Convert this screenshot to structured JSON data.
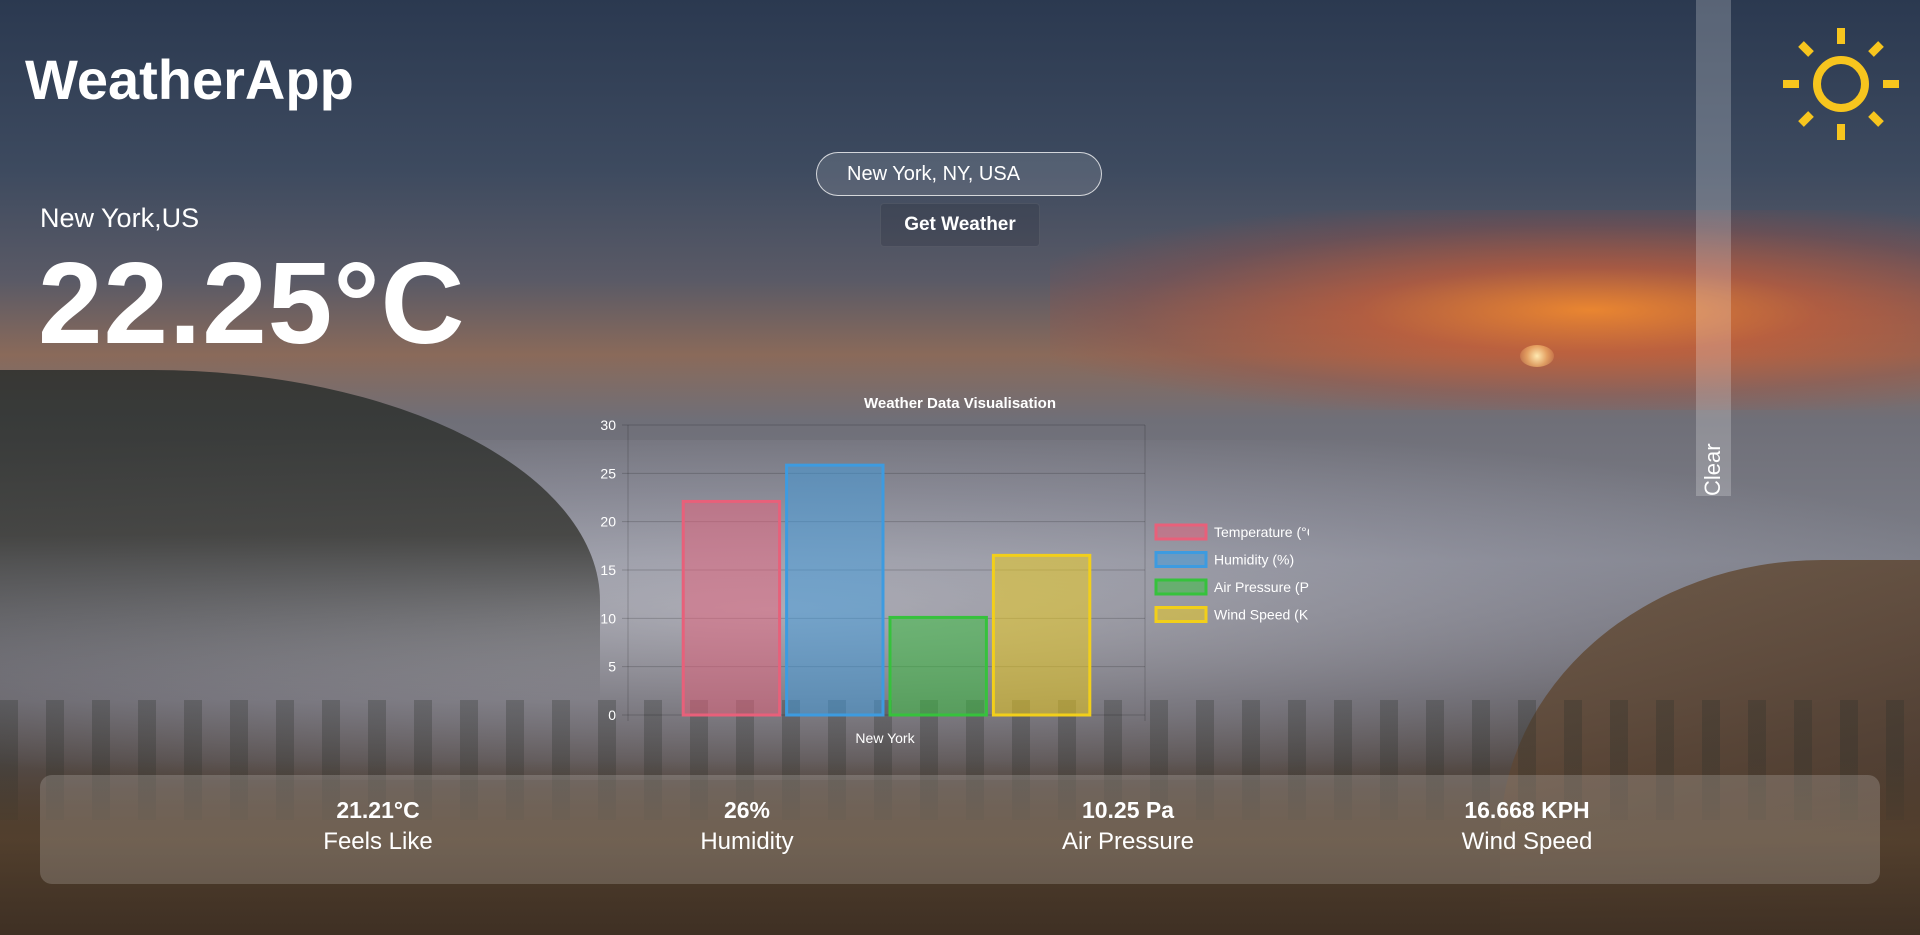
{
  "header": {
    "app_title": "WeatherApp"
  },
  "icons": {
    "weather_condition": "sun-icon",
    "condition_color": "#f7c51e"
  },
  "sidebar": {
    "clear_label": "Clear"
  },
  "search": {
    "value": "New York, NY, USA",
    "button_label": "Get Weather"
  },
  "current": {
    "location": "New York,US",
    "temperature": "22.25°C"
  },
  "chart_data": {
    "type": "bar",
    "title": "Weather Data Visualisation",
    "categories": [
      "New York"
    ],
    "series": [
      {
        "name": "Temperature (°C)",
        "values": [
          22.25
        ],
        "color": "#e8607a"
      },
      {
        "name": "Humidity (%)",
        "values": [
          26
        ],
        "color": "#3d9be0"
      },
      {
        "name": "Air Pressure (Pa)",
        "values": [
          10.25
        ],
        "color": "#36c23c"
      },
      {
        "name": "Wind Speed (KPH)",
        "values": [
          16.668
        ],
        "color": "#f2cf1a"
      }
    ],
    "ylim": [
      0,
      30
    ],
    "yticks": [
      0,
      5,
      10,
      15,
      20,
      25,
      30
    ],
    "grid": true,
    "legend": "right"
  },
  "stats": [
    {
      "value": "21.21°C",
      "label": "Feels Like"
    },
    {
      "value": "26%",
      "label": "Humidity"
    },
    {
      "value": "10.25 Pa",
      "label": "Air Pressure"
    },
    {
      "value": "16.668 KPH",
      "label": "Wind Speed"
    }
  ]
}
